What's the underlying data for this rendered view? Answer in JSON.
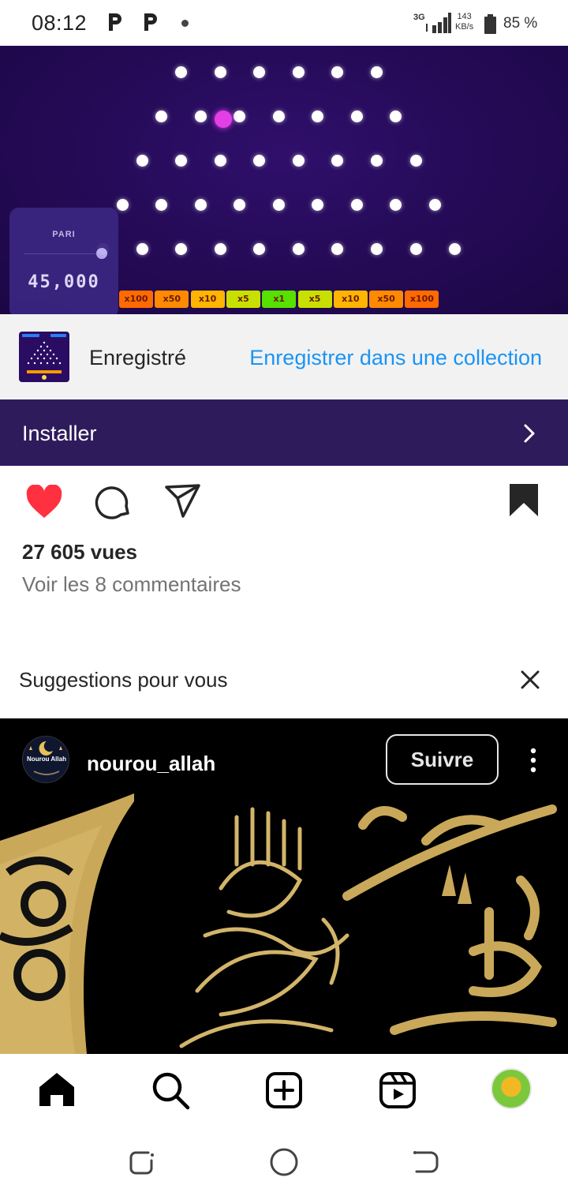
{
  "status_bar": {
    "time": "08:12",
    "network_type": "3G",
    "speed_value": "143",
    "speed_unit": "KB/s",
    "battery": "85 %",
    "icons": [
      "p-notification-icon",
      "p-notification-icon",
      "dot-icon",
      "signal-icon",
      "battery-icon"
    ]
  },
  "game_ad": {
    "bet_label": "PARI",
    "bet_value": "45,000",
    "multipliers": [
      "x100",
      "x50",
      "x10",
      "x5",
      "x1",
      "x5",
      "x10",
      "x50",
      "x100"
    ],
    "multiplier_colors": [
      "#ff6a00",
      "#ff8a00",
      "#ffb400",
      "#c8e000",
      "#57e000",
      "#c8e000",
      "#ffb400",
      "#ff8a00",
      "#ff6a00"
    ],
    "peg_color": "#ffffff",
    "ball_color": "#e23fe6",
    "background": "#240a55"
  },
  "saved": {
    "status": "Enregistré",
    "collection_link": "Enregistrer dans une collection",
    "link_color": "#1a94f5"
  },
  "install": {
    "label": "Installer",
    "background": "#2e1b5c"
  },
  "actions": {
    "like_state": "liked",
    "like_color": "#ff3040",
    "saved_state": "saved",
    "icons": [
      "heart-icon",
      "comment-icon",
      "share-icon",
      "bookmark-icon"
    ]
  },
  "post_meta": {
    "views": "27 605 vues",
    "comments_link": "Voir les 8 commentaires"
  },
  "suggestions": {
    "title": "Suggestions pour vous",
    "post": {
      "username": "nourou_allah",
      "avatar_label": "Nourou Allah",
      "follow_label": "Suivre",
      "art_colors": [
        "#000000",
        "#c9a85a"
      ]
    }
  },
  "bottom_nav": {
    "items": [
      "home-icon",
      "search-icon",
      "create-icon",
      "reels-icon",
      "profile-avatar"
    ],
    "active": "home"
  },
  "system_nav": [
    "recents-icon",
    "home-circle-icon",
    "back-icon"
  ]
}
